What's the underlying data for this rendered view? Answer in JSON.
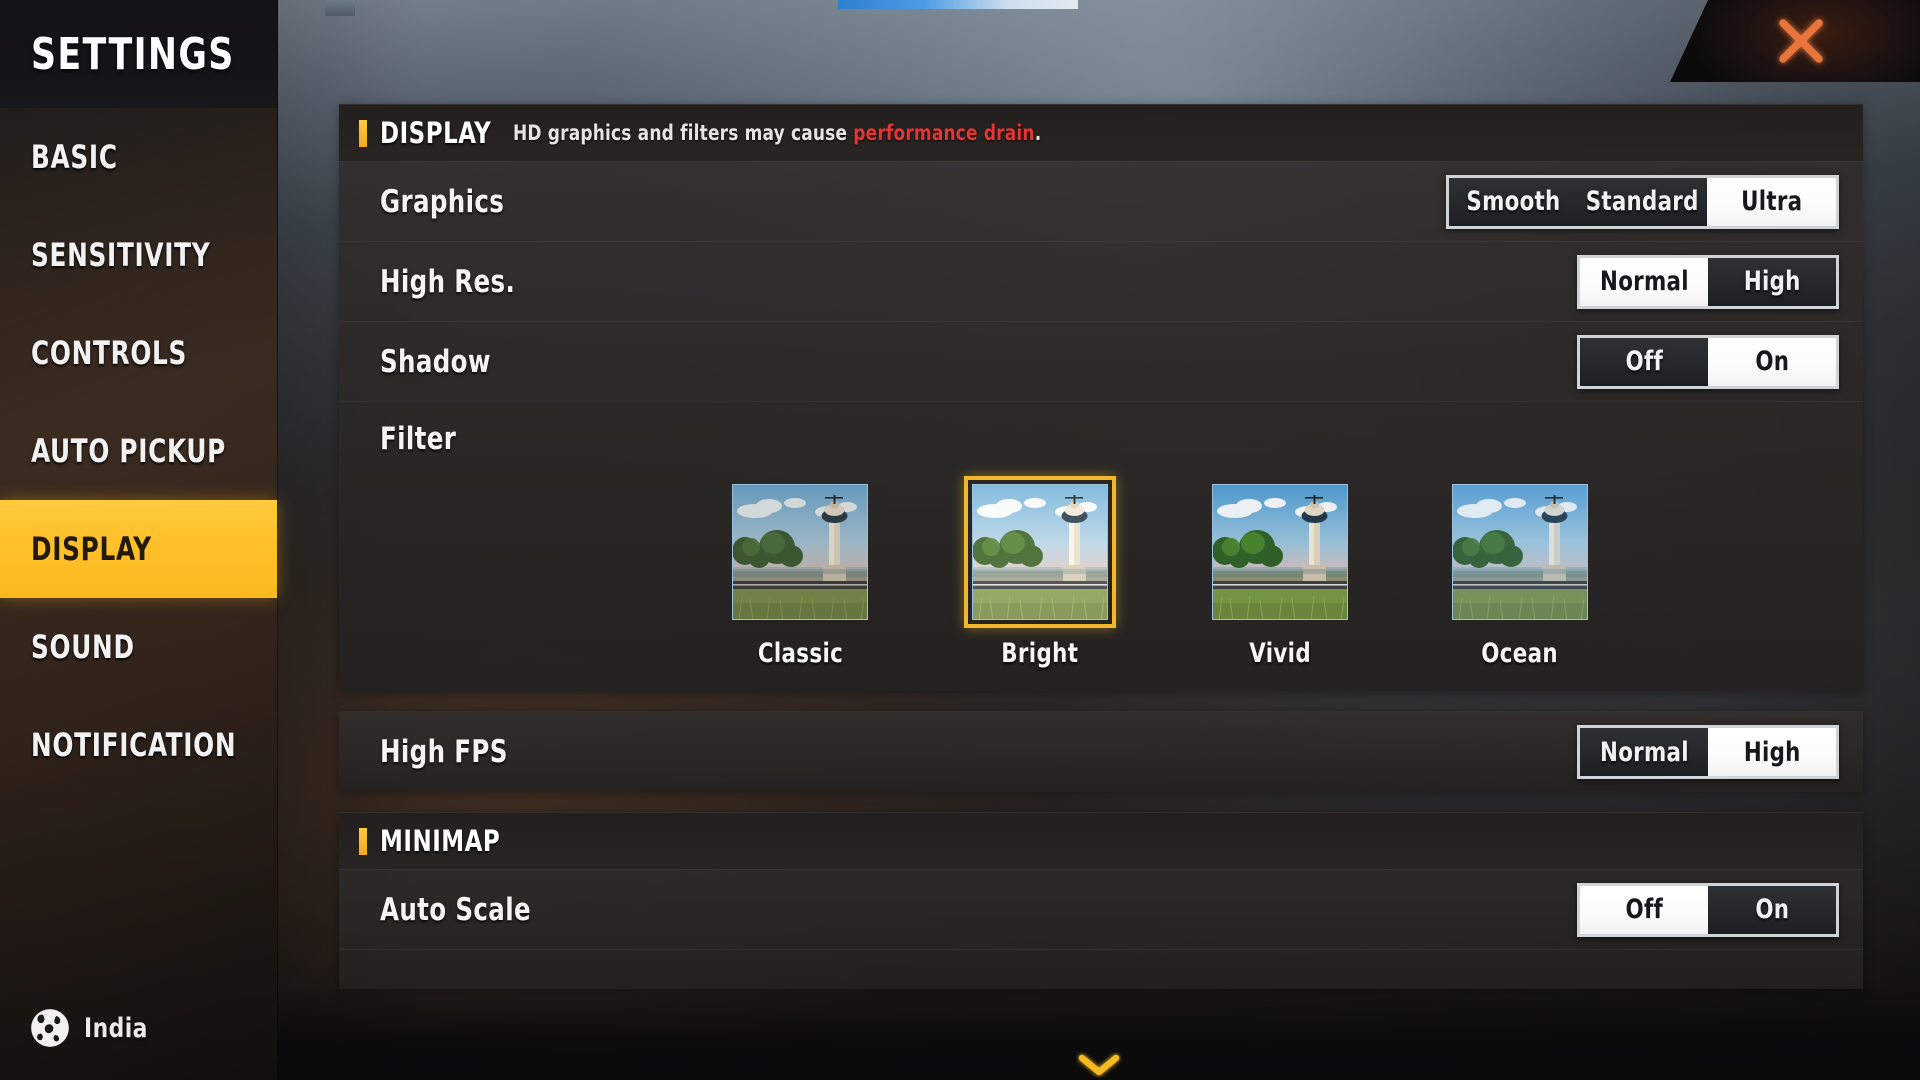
{
  "window": {
    "title": "SETTINGS",
    "close_icon": "close-icon"
  },
  "sidebar": {
    "items": [
      {
        "label": "BASIC",
        "active": false
      },
      {
        "label": "SENSITIVITY",
        "active": false
      },
      {
        "label": "CONTROLS",
        "active": false
      },
      {
        "label": "AUTO PICKUP",
        "active": false
      },
      {
        "label": "DISPLAY",
        "active": true
      },
      {
        "label": "SOUND",
        "active": false
      },
      {
        "label": "NOTIFICATION",
        "active": false
      }
    ],
    "region": {
      "icon": "globe-icon",
      "label": "India"
    }
  },
  "display_section": {
    "title": "DISPLAY",
    "note_prefix": "HD graphics and filters may cause ",
    "note_warning": "performance drain",
    "note_suffix": ".",
    "rows": [
      {
        "label": "Graphics",
        "options": [
          "Smooth",
          "Standard",
          "Ultra"
        ],
        "selected": "Ultra"
      },
      {
        "label": "High Res.",
        "options": [
          "Normal",
          "High"
        ],
        "selected": "Normal"
      },
      {
        "label": "Shadow",
        "options": [
          "Off",
          "On"
        ],
        "selected": "On"
      }
    ],
    "filter": {
      "label": "Filter",
      "options": [
        "Classic",
        "Bright",
        "Vivid",
        "Ocean"
      ],
      "selected": "Bright"
    }
  },
  "fps_section": {
    "rows": [
      {
        "label": "High FPS",
        "options": [
          "Normal",
          "High"
        ],
        "selected": "High"
      }
    ]
  },
  "minimap_section": {
    "title": "MINIMAP",
    "rows": [
      {
        "label": "Auto Scale",
        "options": [
          "Off",
          "On"
        ],
        "selected": "Off"
      }
    ]
  },
  "scroll": {
    "icon": "chevron-down-icon"
  },
  "colors": {
    "accent_yellow": "#FFC12B",
    "accent_gold": "#F2B72B",
    "warning_red": "#E53535",
    "close_orange": "#E8743A",
    "selected_bg": "#FFFFFF",
    "selected_text": "#16181A"
  }
}
